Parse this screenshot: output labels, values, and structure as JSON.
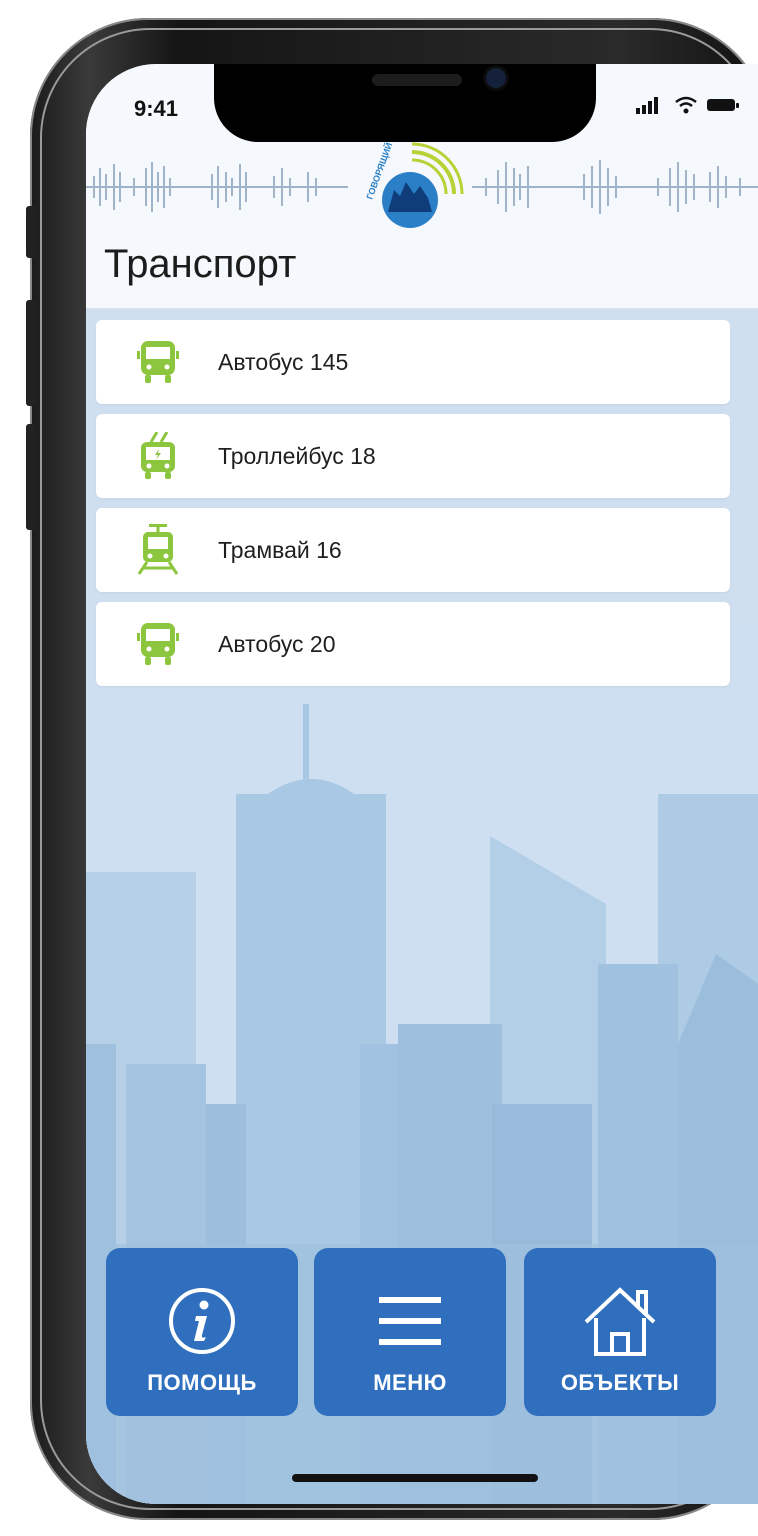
{
  "status_bar": {
    "time": "9:41"
  },
  "header": {
    "title": "Транспорт"
  },
  "logo": {
    "text": "ГОВОРЯЩИЙ ГОРОД"
  },
  "transport_list": [
    {
      "icon": "bus-icon",
      "label": "Автобус 145"
    },
    {
      "icon": "trolleybus-icon",
      "label": "Троллейбус 18"
    },
    {
      "icon": "tram-icon",
      "label": "Трамвай 16"
    },
    {
      "icon": "bus-icon",
      "label": "Автобус 20"
    }
  ],
  "bottom_nav": [
    {
      "icon": "info-icon",
      "label": "ПОМОЩЬ"
    },
    {
      "icon": "menu-icon",
      "label": "МЕНЮ"
    },
    {
      "icon": "home-icon",
      "label": "ОБЪЕКТЫ"
    }
  ],
  "colors": {
    "accent_green": "#8cc63f",
    "button_blue": "#2f6fbe",
    "background_blue": "#cfdff0"
  }
}
